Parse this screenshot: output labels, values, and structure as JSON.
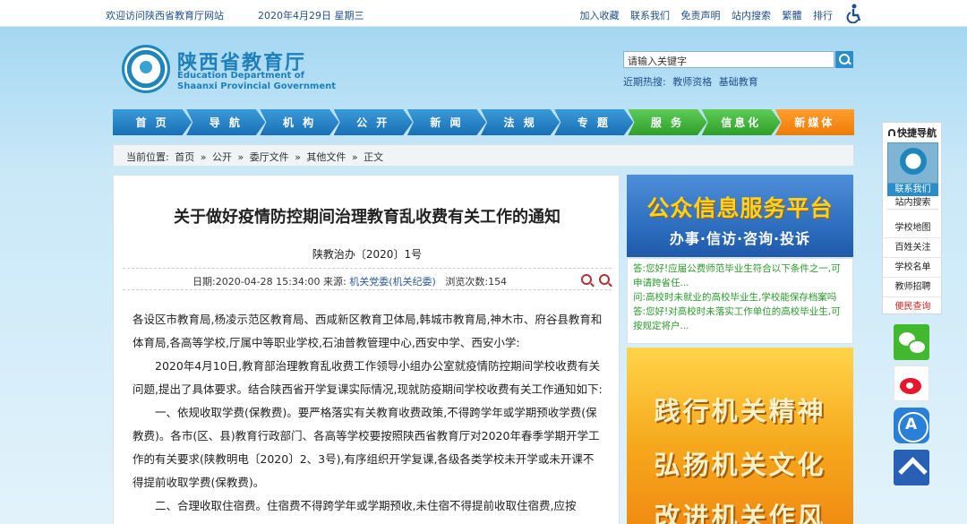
{
  "topbar": {
    "welcome": "欢迎访问陕西省教育厅网站",
    "date": "2020年4月29日 星期三",
    "links": [
      "加入收藏",
      "联系我们",
      "免责声明",
      "站内搜索",
      "繁體",
      "排行"
    ],
    "access_icon": "accessibility-icon"
  },
  "header": {
    "title_cn": "陕西省教育厅",
    "title_en_1": "Education Department of",
    "title_en_2": "Shaanxi Provincial Government"
  },
  "search": {
    "value": "请输入关键字",
    "hot_label": "近期热搜:",
    "hot_keywords": [
      "教师资格",
      "基础教育"
    ]
  },
  "nav": {
    "items": [
      "首 页",
      "导 航",
      "机 构",
      "公 开",
      "新 闻",
      "法 规",
      "专 题",
      "服 务",
      "信息化",
      "新媒体"
    ]
  },
  "breadcrumb": [
    "当前位置:",
    "首页",
    "»",
    "公开",
    "»",
    "委厅文件",
    "»",
    "其他文件",
    "»",
    "正文"
  ],
  "article": {
    "title": "关于做好疫情防控期间治理教育乱收费有关工作的通知",
    "doc_no": "陕教治办〔2020〕1号",
    "meta_date": "日期:2020-04-28 15:34:00",
    "meta_source_label": "来源:",
    "meta_source": "机关党委(机关纪委)",
    "meta_views": "浏览次数:154",
    "paragraphs": [
      "各设区市教育局,杨凌示范区教育局、西咸新区教育卫体局,韩城市教育局,神木市、府谷县教育和体育局,各高等学校,厅属中等职业学校,石油普教管理中心,西安中学、西安小学:",
      "2020年4月10日,教育部治理教育乱收费工作领导小组办公室就疫情防控期间学校收费有关问题,提出了具体要求。结合陕西省开学复课实际情况,现就防疫期间学校收费有关工作通知如下:",
      "一、依规收取学费(保教费)。要严格落实有关教育收费政策,不得跨学年或学期预收学费(保教费)。各市(区、县)教育行政部门、各高等学校要按照陕西省教育厅对2020年春季学期开学工作的有关要求(陕教明电〔2020〕2、3号),有序组织开学复课,各级各类学校未开学或未开课不得提前收取学费(保教费)。",
      "二、合理收取住宿费。住宿费不得跨学年或学期预收,未住宿不得提前收取住宿费,应按"
    ]
  },
  "right": {
    "banner1_title": "公众信息服务平台",
    "banner1_sub": "办事·信访·咨询·投诉",
    "qa": [
      {
        "tag": "答:",
        "text": "您好!应届公费师范毕业生符合以下条件之一,可申请跨省任..."
      },
      {
        "tag": "问:",
        "text": "高校时未就业的高校毕业生,学校能保存档案吗"
      },
      {
        "tag": "答:",
        "text": "您好!对高校时未落实工作单位的高校毕业生,可按规定将户..."
      }
    ],
    "banner2_lines": [
      "践行机关精神",
      "弘扬机关文化",
      "改进机关作风"
    ]
  },
  "side": {
    "title": "快捷导航",
    "contact": "联系我们",
    "search": "站内搜索",
    "items": [
      "学校地图",
      "百姓关注",
      "学校名单",
      "教师招聘"
    ],
    "highlight": "便民查询"
  }
}
